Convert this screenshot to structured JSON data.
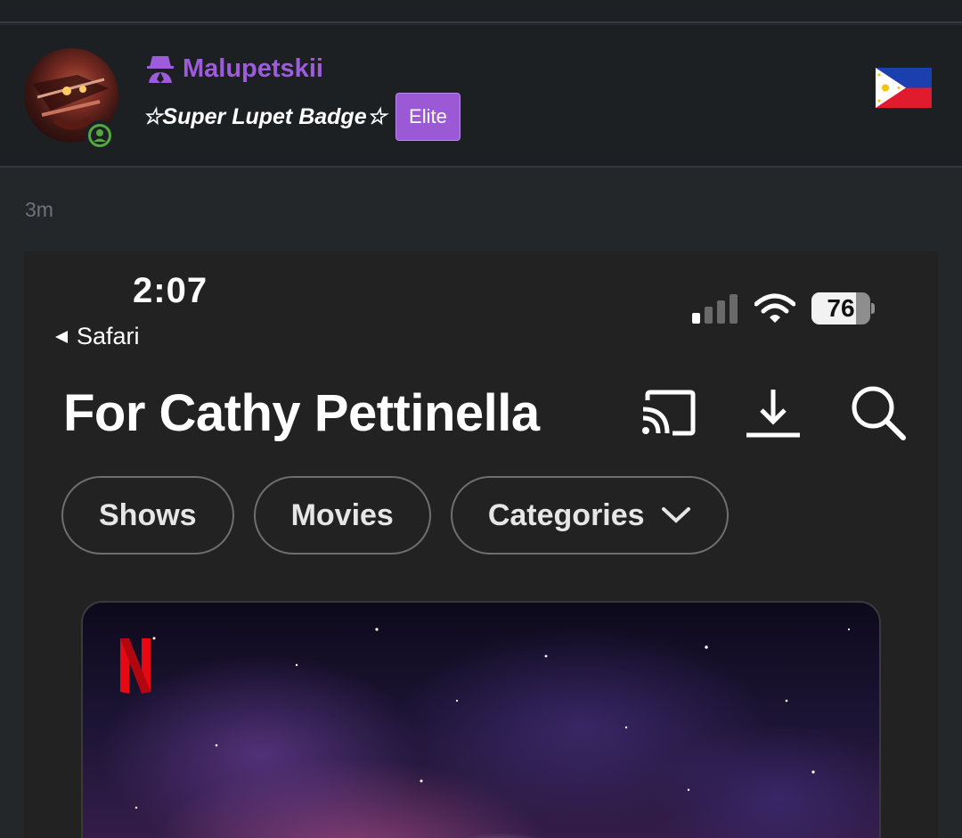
{
  "post": {
    "username": "Malupetskii",
    "badge_title": "☆Super Lupet Badge☆",
    "rank_label": "Elite",
    "timestamp": "3m"
  },
  "screenshot": {
    "status": {
      "time": "2:07",
      "back_app": "Safari",
      "battery_percent": 76
    },
    "title": "For Cathy Pettinella",
    "pills": [
      {
        "label": "Shows"
      },
      {
        "label": "Movies"
      },
      {
        "label": "Categories"
      }
    ],
    "icons": [
      "cast-icon",
      "download-icon",
      "search-icon",
      "chevron-down-icon",
      "netflix-logo"
    ]
  },
  "colors": {
    "username": "#9d5cdb",
    "elite_badge": "#9b59d6",
    "online": "#53a93f",
    "netflix_red": "#e50914"
  }
}
